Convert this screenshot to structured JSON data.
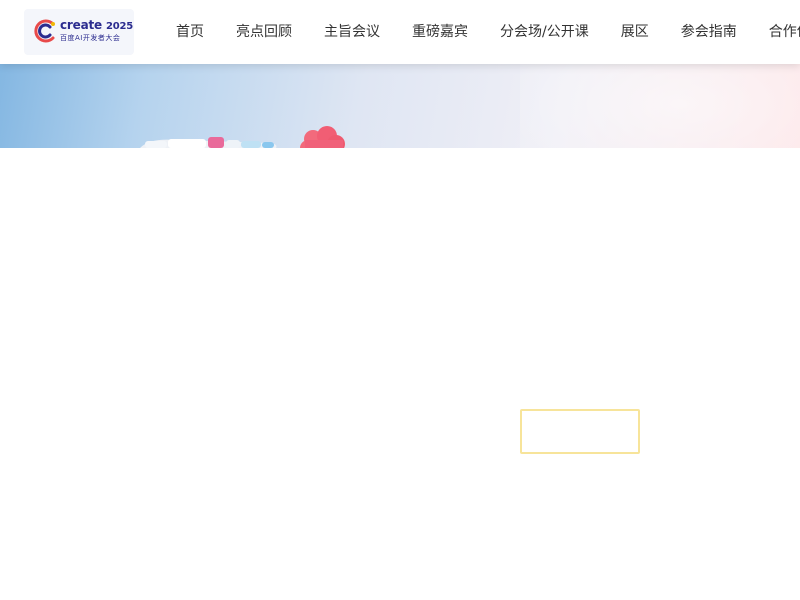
{
  "header": {
    "logo": {
      "wordmark": "create",
      "year": "2025",
      "subtitle": "百度AI开发者大会",
      "icon": "create-logo-icon",
      "brand_color": "#2B2C8F"
    },
    "nav": [
      {
        "label": "首页"
      },
      {
        "label": "亮点回顾"
      },
      {
        "label": "主旨会议"
      },
      {
        "label": "重磅嘉宾"
      },
      {
        "label": "分会场/公开课"
      },
      {
        "label": "展区"
      },
      {
        "label": "参会指南"
      },
      {
        "label": "合作伙伴"
      }
    ]
  },
  "hero": {
    "colors": {
      "left": "#84B7E2",
      "mid": "#DFE6F3",
      "right": "#FDE6E8"
    },
    "decorations": [
      "bracelet-decoration",
      "clover-decoration"
    ]
  },
  "cta": {
    "outline_color": "#F7E49A"
  }
}
